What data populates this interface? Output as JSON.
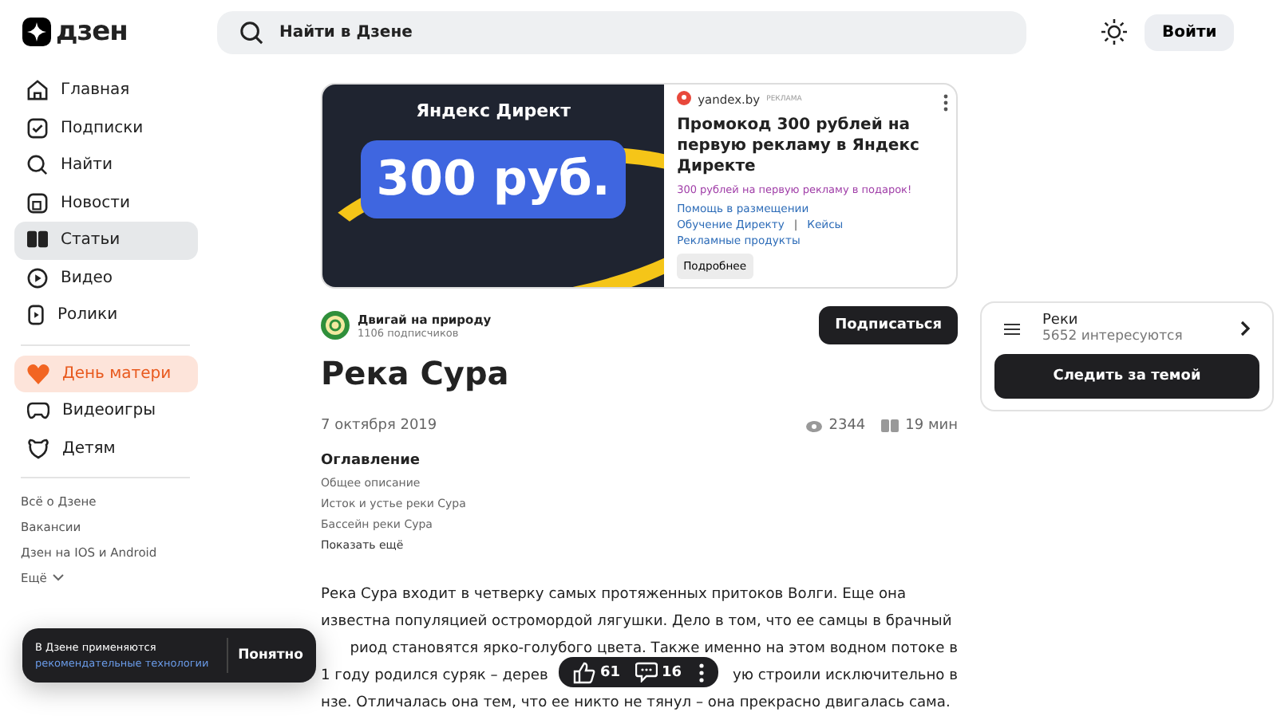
{
  "header": {
    "logo": "дзен",
    "search": {
      "placeholder": "Найти в Дзене"
    },
    "login": "Войти"
  },
  "sidebar": {
    "items": [
      {
        "label": "Главная",
        "selected": false
      },
      {
        "label": "Подписки",
        "selected": false
      },
      {
        "label": "Найти",
        "selected": false
      },
      {
        "label": "Новости",
        "selected": false
      },
      {
        "label": "Статьи",
        "selected": true
      },
      {
        "label": "Видео",
        "selected": false
      },
      {
        "label": "Ролики",
        "selected": false
      }
    ],
    "special": [
      {
        "label": "День матери",
        "highlighted": true
      },
      {
        "label": "Видеоигры",
        "highlighted": false
      },
      {
        "label": "Детям",
        "highlighted": false
      }
    ],
    "links": [
      "Всё о Дзене",
      "Вакансии",
      "Дзен на IOS и Android"
    ],
    "more": "Ещё"
  },
  "ad": {
    "banner_brand": "Яндекс Директ",
    "banner_price": "300 руб.",
    "domain": "yandex.by",
    "ad_label": "РЕКЛАМА",
    "title": "Промокод 300 рублей на первую рекламу в Яндекс Директе",
    "subtitle": "300 рублей на первую рекламу в подарок!",
    "links": [
      [
        "Помощь в размещении"
      ],
      [
        "Обучение Директу",
        "Кейсы"
      ],
      [
        "Рекламные продукты"
      ]
    ],
    "link_separator": "|",
    "button": "Подробнее"
  },
  "channel": {
    "name": "Двигай на природу",
    "subscribers": "1106 подписчиков",
    "subscribe": "Подписаться"
  },
  "article": {
    "title": "Река Сура",
    "date": "7 октября 2019",
    "views": "2344",
    "read_time": "19 мин",
    "toc": {
      "heading": "Оглавление",
      "items": [
        "Общее описание",
        "Исток и устье реки Сура",
        "Бассейн реки Сура"
      ],
      "more": "Показать ещё"
    },
    "lines": [
      [
        "Река Сура входит в четверку самых протяженных притоков Волги. Еще она"
      ],
      [
        "известна популяцией остромордой лягушки. Дело в том, что ее самцы в брачный"
      ],
      [
        "риод становятся ярко-голубого цвета. Также именно на этом водном потоке в"
      ],
      [
        "1 году родился суряк – дерев",
        "ую строили исключительно в"
      ],
      [
        "нзе. Отличалась она тем, что ее никто не тянул – она прекрасно двигалась сама."
      ]
    ]
  },
  "topic": {
    "name": "Реки",
    "followers": "5652 интересуются",
    "follow": "Следить за темой"
  },
  "cookie": {
    "text": "В Дзене применяются",
    "link": "рекомендательные технологии",
    "ok": "Понятно"
  },
  "actions": {
    "likes": "61",
    "comments": "16"
  }
}
